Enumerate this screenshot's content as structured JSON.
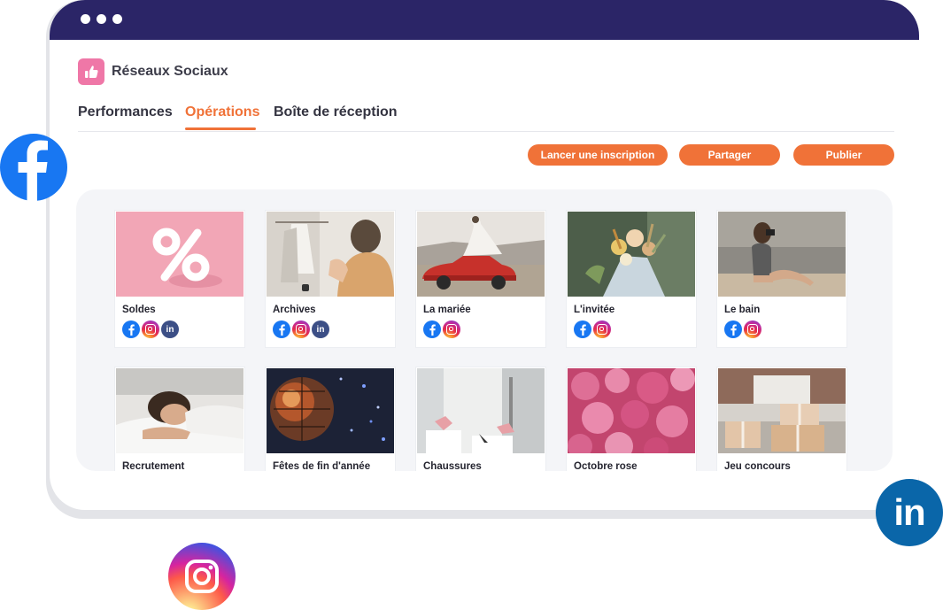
{
  "app": {
    "title": "Réseaux Sociaux"
  },
  "tabs": [
    {
      "label": "Performances",
      "active": false
    },
    {
      "label": "Opérations",
      "active": true
    },
    {
      "label": "Boîte de réception",
      "active": false
    }
  ],
  "actions": {
    "subscribe_label": "Lancer une inscription",
    "share_label": "Partager",
    "publish_label": "Publier"
  },
  "colors": {
    "titlebar": "#2b2567",
    "accent": "#f07238",
    "app_icon": "#ef77a7",
    "facebook": "#1877f2",
    "linkedin": "#0a66a9"
  },
  "operations": [
    {
      "label": "Soldes",
      "image": "percent-sign",
      "networks": [
        "facebook",
        "instagram",
        "linkedin"
      ]
    },
    {
      "label": "Archives",
      "image": "woman-clothes-rack",
      "networks": [
        "facebook",
        "instagram",
        "linkedin"
      ]
    },
    {
      "label": "La mariée",
      "image": "bride-red-car",
      "networks": [
        "facebook",
        "instagram"
      ]
    },
    {
      "label": "L'invitée",
      "image": "flower-bouquet",
      "networks": [
        "facebook",
        "instagram"
      ]
    },
    {
      "label": "Le bain",
      "image": "woman-beach-camera",
      "networks": [
        "facebook",
        "instagram"
      ]
    },
    {
      "label": "Recrutement",
      "image": "woman-sleeping",
      "networks": []
    },
    {
      "label": "Fêtes de fin d'année",
      "image": "disco-ball",
      "networks": []
    },
    {
      "label": "Chaussures",
      "image": "shoes-room",
      "networks": []
    },
    {
      "label": "Octobre rose",
      "image": "pink-flowers",
      "networks": []
    },
    {
      "label": "Jeu concours",
      "image": "gift-boxes",
      "networks": []
    }
  ],
  "floating_icons": [
    {
      "name": "facebook-logo-icon"
    },
    {
      "name": "linkedin-logo-icon",
      "text": "in"
    },
    {
      "name": "instagram-logo-icon"
    }
  ]
}
